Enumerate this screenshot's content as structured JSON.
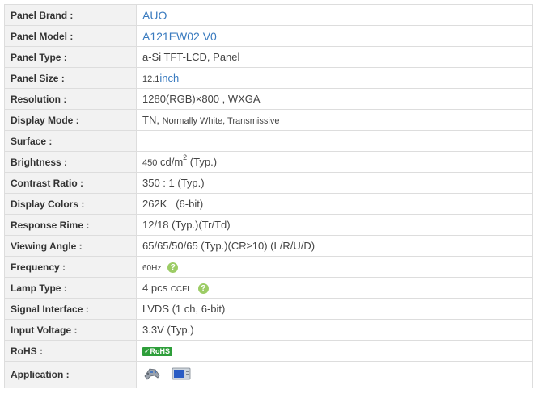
{
  "colors": {
    "label_bg": "#f2f2f2",
    "border": "#dddddd",
    "link": "#3a7bbf",
    "help_green": "#9ccc65",
    "rohs_green": "#2e9e3a"
  },
  "rows": {
    "brand": {
      "label": "Panel Brand :",
      "value": "AUO"
    },
    "model": {
      "label": "Panel Model :",
      "value": "A121EW02 V0"
    },
    "type": {
      "label": "Panel Type :",
      "value": "a-Si TFT-LCD, Panel"
    },
    "size": {
      "label": "Panel Size :",
      "number": "12.1",
      "unit": "inch"
    },
    "resolution": {
      "label": "Resolution :",
      "value": "1280(RGB)×800 , WXGA"
    },
    "display_mode": {
      "label": "Display Mode :",
      "tn": "TN,",
      "rest": "Normally White, Transmissive"
    },
    "surface": {
      "label": "Surface :",
      "value": ""
    },
    "brightness": {
      "label": "Brightness :",
      "number": "450",
      "unit": "cd/m",
      "sup": "2",
      "note": "(Typ.)"
    },
    "contrast": {
      "label": "Contrast Ratio :",
      "value": "350 : 1 (Typ.)"
    },
    "colors_row": {
      "label": "Display Colors :",
      "value": "262K   (6-bit)"
    },
    "response": {
      "label": "Response Rime :",
      "value": "12/18 (Typ.)(Tr/Td)"
    },
    "viewing": {
      "label": "Viewing Angle :",
      "value": "65/65/50/65 (Typ.)(CR≥10) (L/R/U/D)"
    },
    "frequency": {
      "label": "Frequency :",
      "value": "60Hz",
      "help_icon": "question-circle-icon",
      "help_glyph": "?"
    },
    "lamp": {
      "label": "Lamp Type :",
      "count": "4 pcs",
      "kind": "CCFL",
      "help_icon": "question-circle-icon",
      "help_glyph": "?"
    },
    "signal": {
      "label": "Signal Interface :",
      "value": "LVDS (1 ch, 6-bit)"
    },
    "voltage": {
      "label": "Input Voltage :",
      "value": "3.3V (Typ.)"
    },
    "rohs": {
      "label": "RoHS :",
      "check": "✓",
      "badge": "RoHS"
    },
    "application": {
      "label": "Application :",
      "icons": [
        "game-controller-icon",
        "portable-monitor-icon"
      ]
    }
  }
}
